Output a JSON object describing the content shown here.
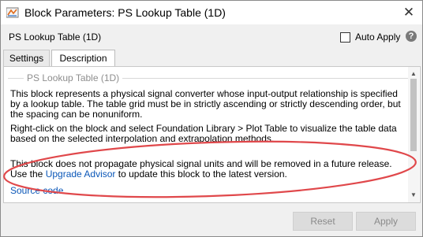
{
  "window": {
    "title": "Block Parameters: PS Lookup Table (1D)",
    "close_glyph": "✕"
  },
  "header": {
    "block_name": "PS Lookup Table (1D)",
    "auto_apply_label": "Auto Apply",
    "auto_apply_checked": false,
    "help_glyph": "?"
  },
  "tabs": [
    {
      "label": "Settings",
      "active": false
    },
    {
      "label": "Description",
      "active": true
    }
  ],
  "description": {
    "legend": "PS Lookup Table (1D)",
    "paragraph1": "This block represents a physical signal converter whose input-output relationship is specified by a lookup table. The table grid must be in strictly ascending or strictly descending order, but the spacing can be nonuniform.",
    "paragraph2": "Right-click on the block and select Foundation Library > Plot Table to visualize the table data based on the selected interpolation and extrapolation methods.",
    "paragraph3_before": "This block does not propagate physical signal units and will be removed in a future release. Use the ",
    "paragraph3_link": "Upgrade Advisor",
    "paragraph3_after": " to update this block to the latest version.",
    "source_link": "Source code"
  },
  "footer": {
    "reset_label": "Reset",
    "apply_label": "Apply"
  },
  "colors": {
    "link": "#0b57b8",
    "annotation_oval": "#e0484b",
    "disabled_text": "#8a8a8a"
  },
  "icons": [
    "simulink-app-icon",
    "close-icon",
    "checkbox-icon",
    "help-icon",
    "scroll-up-icon",
    "scroll-down-icon"
  ]
}
